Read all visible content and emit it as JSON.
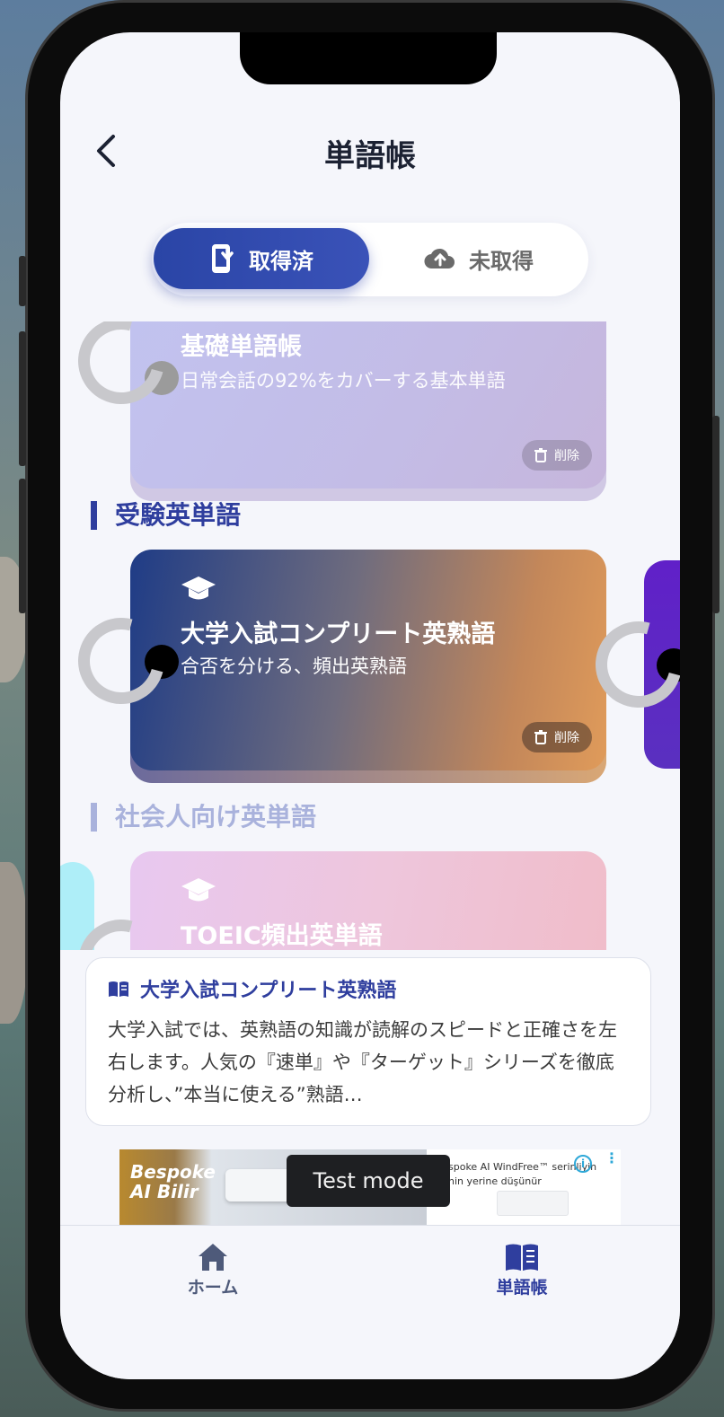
{
  "header": {
    "title": "単語帳"
  },
  "segment": {
    "tabs": [
      {
        "label": "取得済",
        "active": true
      },
      {
        "label": "未取得",
        "active": false
      }
    ]
  },
  "cards": {
    "basic": {
      "title": "基礎単語帳",
      "subtitle": "日常会話の92%をカバーする基本単語",
      "delete_label": "削除"
    },
    "exam_section": "受験英単語",
    "exam": {
      "title": "大学入試コンプリート英熟語",
      "subtitle": "合否を分ける、頻出英熟語",
      "delete_label": "削除"
    },
    "business_section": "社会人向け英単語",
    "toeic": {
      "title": "TOEIC頻出英単語"
    }
  },
  "description": {
    "title": "大学入試コンプリート英熟語",
    "text": "大学入試では、英熟語の知識が読解のスピードと正確さを左右します。人気の『速単』や『ターゲット』シリーズを徹底分析し、”本当に使える”熟語…"
  },
  "ad": {
    "logo_line1": "Bespoke",
    "logo_line2": "AI Bilir",
    "text_line1": "spoke AI WindFree™ serinliyin",
    "text_line2": "nin yerine düşünür",
    "info_icon": "i",
    "test_mode": "Test mode"
  },
  "tabbar": {
    "items": [
      {
        "label": "ホーム",
        "icon": "home-icon",
        "active": false
      },
      {
        "label": "単語帳",
        "icon": "book-icon",
        "active": true
      }
    ]
  },
  "colors": {
    "accent": "#2f3e9e",
    "background": "#f5f6fb",
    "inactive_tab": "#4e5a7a"
  }
}
